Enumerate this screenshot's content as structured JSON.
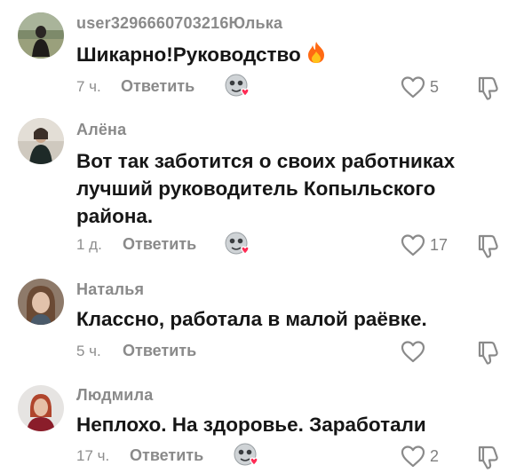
{
  "comments": [
    {
      "username": "user3296660703216Юлька",
      "text": "Шикарно!Руководство",
      "emoji": "fire-icon",
      "time": "7 ч.",
      "reply_label": "Ответить",
      "creator_liked": true,
      "likes": "5"
    },
    {
      "username": "Алёна",
      "text": "Вот так заботится о своих работниках\nлучший руководитель Копыльского\nрайона.",
      "time": "1 д.",
      "reply_label": "Ответить",
      "creator_liked": true,
      "likes": "17"
    },
    {
      "username": "Наталья",
      "text": "Классно, работала в малой раёвке.",
      "time": "5 ч.",
      "reply_label": "Ответить",
      "creator_liked": false,
      "likes": ""
    },
    {
      "username": "Людмила",
      "text": "Неплохо. На здоровье. Заработали",
      "time": "17 ч.",
      "reply_label": "Ответить",
      "creator_liked": true,
      "likes": "2"
    }
  ],
  "icons": {
    "like": "heart-outline-icon",
    "dislike": "thumbs-down-icon",
    "creator_like": "creator-liked-avatar-icon"
  },
  "colors": {
    "text": "#161616",
    "secondary": "#8a8a8a",
    "heart_accent": "#fe2c55",
    "fire": "#ff6a13"
  }
}
